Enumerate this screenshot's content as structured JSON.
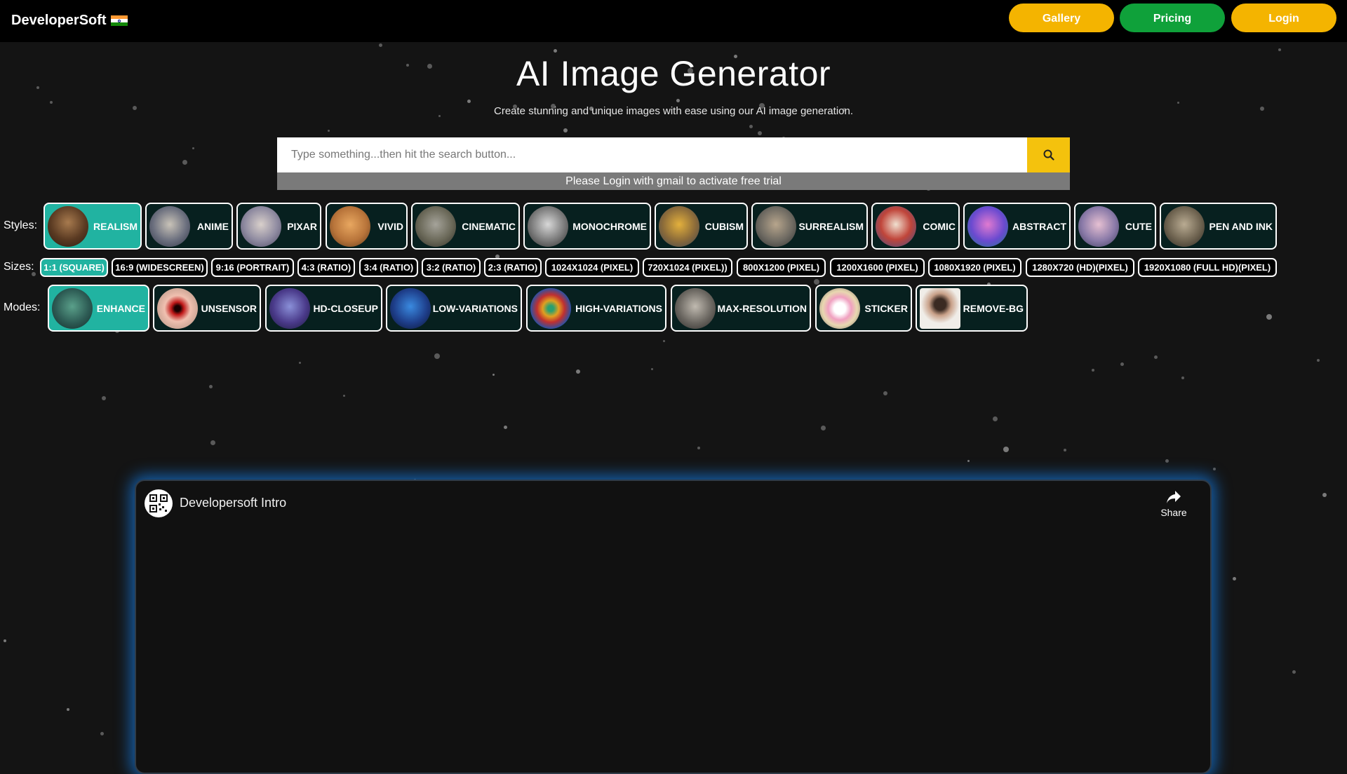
{
  "header": {
    "brand": "DeveloperSoft",
    "flag_icon": "india-flag-icon",
    "nav": {
      "gallery": "Gallery",
      "pricing": "Pricing",
      "login": "Login"
    },
    "colors": {
      "gallery": "#F4B400",
      "pricing": "#0FA13A",
      "login": "#F4B400"
    }
  },
  "hero": {
    "title": "AI Image Generator",
    "subtitle": "Create stunning and unique images with ease using our AI image generation."
  },
  "search": {
    "placeholder": "Type something...then hit the search button...",
    "value": "",
    "button_icon": "search-icon"
  },
  "notice": "Please Login with gmail to activate free trial",
  "styles": {
    "label": "Styles:",
    "selected": "REALISM",
    "items": [
      {
        "label": "REALISM",
        "active": true
      },
      {
        "label": "ANIME",
        "active": false
      },
      {
        "label": "PIXAR",
        "active": false
      },
      {
        "label": "VIVID",
        "active": false
      },
      {
        "label": "CINEMATIC",
        "active": false
      },
      {
        "label": "MONOCHROME",
        "active": false
      },
      {
        "label": "CUBISM",
        "active": false
      },
      {
        "label": "SURREALISM",
        "active": false
      },
      {
        "label": "COMIC",
        "active": false
      },
      {
        "label": "ABSTRACT",
        "active": false
      },
      {
        "label": "CUTE",
        "active": false
      },
      {
        "label": "PEN AND INK",
        "active": false
      }
    ]
  },
  "sizes": {
    "label": "Sizes:",
    "selected": "1:1 (SQUARE)",
    "items": [
      {
        "label": "1:1 (SQUARE)",
        "active": true
      },
      {
        "label": "16:9 (WIDESCREEN)",
        "active": false
      },
      {
        "label": "9:16 (PORTRAIT)",
        "active": false
      },
      {
        "label": "4:3 (RATIO)",
        "active": false
      },
      {
        "label": "3:4 (RATIO)",
        "active": false
      },
      {
        "label": "3:2 (RATIO)",
        "active": false
      },
      {
        "label": "2:3 (RATIO)",
        "active": false
      },
      {
        "label": "1024X1024 (PIXEL)",
        "active": false
      },
      {
        "label": "720X1024 (PIXEL))",
        "active": false
      },
      {
        "label": "800X1200 (PIXEL)",
        "active": false
      },
      {
        "label": "1200X1600 (PIXEL)",
        "active": false
      },
      {
        "label": "1080X1920 (PIXEL)",
        "active": false
      },
      {
        "label": "1280X720 (HD)(PIXEL)",
        "active": false
      },
      {
        "label": "1920X1080 (FULL HD)(PIXEL)",
        "active": false
      }
    ]
  },
  "modes": {
    "label": "Modes:",
    "selected": "ENHANCE",
    "items": [
      {
        "label": "ENHANCE",
        "active": true
      },
      {
        "label": "UNSENSOR",
        "active": false
      },
      {
        "label": "HD-CLOSEUP",
        "active": false
      },
      {
        "label": "LOW-VARIATIONS",
        "active": false
      },
      {
        "label": "HIGH-VARIATIONS",
        "active": false
      },
      {
        "label": "MAX-RESOLUTION",
        "active": false
      },
      {
        "label": "STICKER",
        "active": false
      },
      {
        "label": "REMOVE-BG",
        "active": false
      }
    ]
  },
  "video": {
    "title": "Developersoft Intro",
    "share_label": "Share",
    "share_icon": "share-arrow-icon",
    "channel_icon": "qr-code-avatar-icon"
  },
  "accent_color": "#21b3a1"
}
